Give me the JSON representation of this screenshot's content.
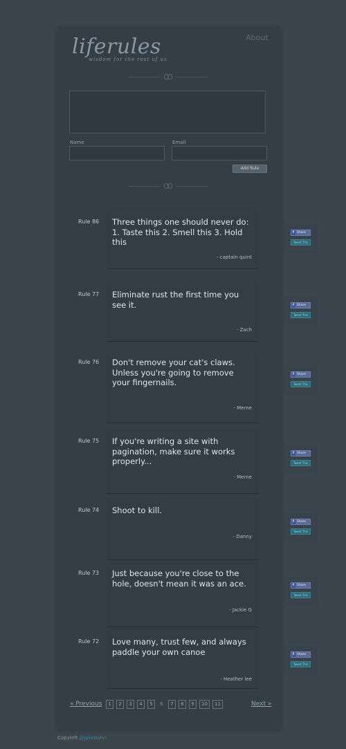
{
  "header": {
    "logo": "liferules",
    "tagline": "wisdom for the rest of us",
    "about": "About"
  },
  "form": {
    "name_label": "Name",
    "email_label": "Email",
    "add_button": "Add Rule"
  },
  "rules": [
    {
      "number": "Rule 86",
      "text": "Three things one should never do: 1. Taste this 2. Smell this 3. Hold this",
      "author": "- captain quint"
    },
    {
      "number": "Rule 77",
      "text": "Eliminate rust the first time you see it.",
      "author": "- Zach"
    },
    {
      "number": "Rule 76",
      "text": "Don't remove your cat's claws. Unless you're going to remove your fingernails.",
      "author": "- Merne"
    },
    {
      "number": "Rule 75",
      "text": "If you're writing a site with pagination, make sure it works properly...",
      "author": "- Merne"
    },
    {
      "number": "Rule 74",
      "text": "Shoot to kill.",
      "author": "- Danny"
    },
    {
      "number": "Rule 73",
      "text": "Just because you're close to the hole, doesn't mean it was an ace.",
      "author": "- Jackie G"
    },
    {
      "number": "Rule 72",
      "text": "Love many, trust few, and always paddle your own canoe",
      "author": "- Heather lee"
    }
  ],
  "share": {
    "facebook": "Share",
    "twitter": "Tweet This"
  },
  "pagination": {
    "previous": "« Previous",
    "next": "Next »",
    "pages": [
      "1",
      "2",
      "3",
      "4",
      "5",
      "6",
      "7",
      "8",
      "9",
      "10",
      "11"
    ],
    "current": "6"
  },
  "footer": {
    "text": "Copyleft",
    "handle": "@jakedahn"
  }
}
